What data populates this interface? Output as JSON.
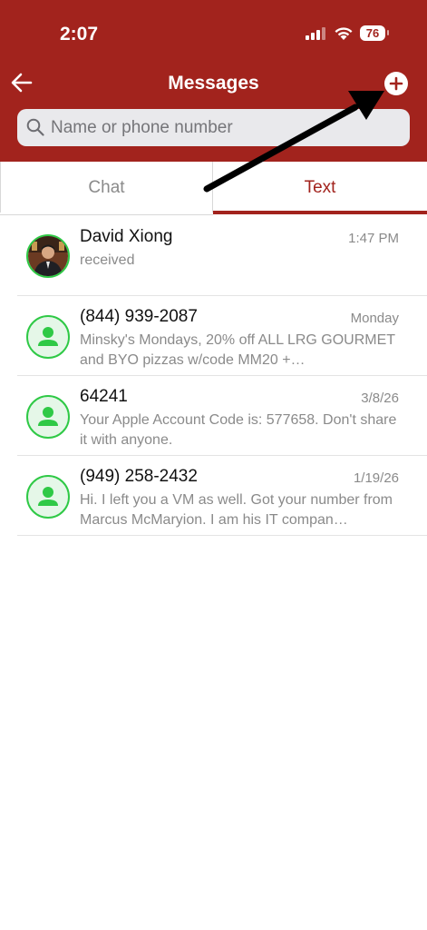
{
  "status_bar": {
    "time": "2:07",
    "battery": "76"
  },
  "header": {
    "title": "Messages"
  },
  "search": {
    "placeholder": "Name or phone number"
  },
  "tabs": [
    {
      "label": "Chat",
      "active": false
    },
    {
      "label": "Text",
      "active": true
    }
  ],
  "conversations": [
    {
      "name": "David Xiong",
      "date": "1:47 PM",
      "preview": "received",
      "avatar": "photo"
    },
    {
      "name": "(844) 939-2087",
      "date": "Monday",
      "preview": "Minsky's Mondays, 20% off ALL LRG GOURMET and BYO pizzas w/code MM20 +…",
      "avatar": "person-icon"
    },
    {
      "name": "64241",
      "date": "3/8/26",
      "preview": "Your Apple Account Code is: 577658. Don't share it with anyone.",
      "avatar": "person-icon"
    },
    {
      "name": "(949) 258-2432",
      "date": "1/19/26",
      "preview": "Hi. I left you a VM as well. Got your number from Marcus McMaryion. I am his IT compan…",
      "avatar": "person-icon"
    }
  ],
  "colors": {
    "brand": "#a2231d",
    "avatar_ring": "#2fc946"
  }
}
